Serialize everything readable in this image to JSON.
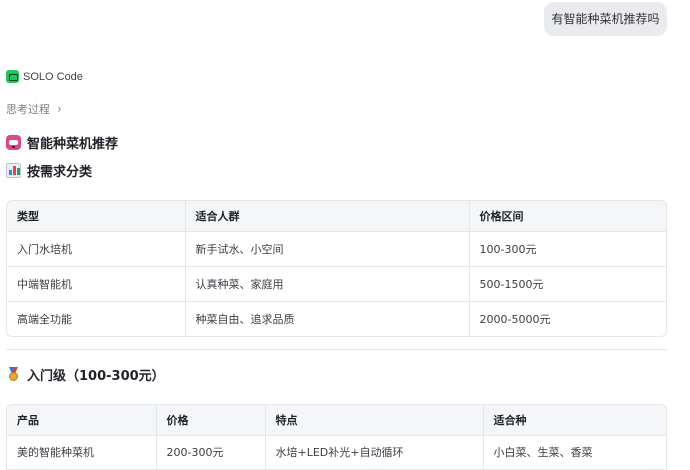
{
  "user_message": "有智能种菜机推荐吗",
  "assistant": {
    "name": "SOLO Code",
    "logo_color": "#22c55e"
  },
  "thinking": {
    "label": "思考过程",
    "chevron": "›"
  },
  "sections": {
    "title": {
      "icon": "robot-icon",
      "text": "智能种菜机推荐"
    },
    "by_need": {
      "icon": "bar-chart-icon",
      "text": "按需求分类"
    },
    "entry": {
      "icon": "medal-icon",
      "text": "入门级（100-300元）"
    }
  },
  "table_categories": {
    "headers": [
      "类型",
      "适合人群",
      "价格区间"
    ],
    "rows": [
      [
        "入门水培机",
        "新手试水、小空间",
        "100-300元"
      ],
      [
        "中端智能机",
        "认真种菜、家庭用",
        "500-1500元"
      ],
      [
        "高端全功能",
        "种菜自由、追求品质",
        "2000-5000元"
      ]
    ]
  },
  "table_entry": {
    "headers": [
      "产品",
      "价格",
      "特点",
      "适合种"
    ],
    "rows": [
      [
        "美的智能种菜机",
        "200-300元",
        "水培+LED补光+自动循环",
        "小白菜、生菜、香菜"
      ]
    ]
  }
}
